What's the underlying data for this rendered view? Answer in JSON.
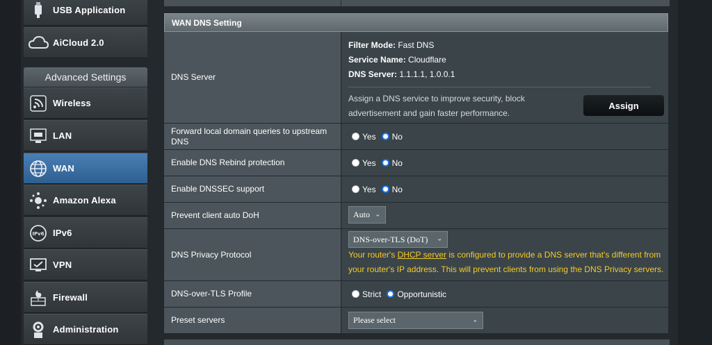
{
  "sidebar": {
    "items_top": [
      {
        "label": "USB Application",
        "icon": "usb-icon"
      },
      {
        "label": "AiCloud 2.0",
        "icon": "cloud-icon"
      }
    ],
    "advanced_header": "Advanced Settings",
    "items": [
      {
        "label": "Wireless",
        "icon": "wireless-icon"
      },
      {
        "label": "LAN",
        "icon": "lan-icon"
      },
      {
        "label": "WAN",
        "icon": "globe-icon",
        "active": true
      },
      {
        "label": "Amazon Alexa",
        "icon": "alexa-icon"
      },
      {
        "label": "IPv6",
        "icon": "ipv6-icon"
      },
      {
        "label": "VPN",
        "icon": "vpn-icon"
      },
      {
        "label": "Firewall",
        "icon": "firewall-icon"
      },
      {
        "label": "Administration",
        "icon": "administration-icon"
      }
    ]
  },
  "section": {
    "title": "WAN DNS Setting"
  },
  "dns_server": {
    "label": "DNS Server",
    "filter_mode_key": "Filter Mode:",
    "filter_mode_val": " Fast DNS",
    "service_name_key": "Service Name:",
    "service_name_val": " Cloudflare",
    "dns_server_key": "DNS Server:",
    "dns_server_val": " 1.1.1.1, 1.0.0.1",
    "assign_desc_1": "Assign a DNS service to improve security, block",
    "assign_desc_2": "advertisement and gain faster performance.",
    "assign_button": "Assign"
  },
  "forward_local": {
    "label": "Forward local domain queries to upstream DNS",
    "yes": "Yes",
    "no": "No",
    "selected": "No"
  },
  "dns_rebind": {
    "label": "Enable DNS Rebind protection",
    "yes": "Yes",
    "no": "No",
    "selected": "No"
  },
  "dnssec": {
    "label": "Enable DNSSEC support",
    "yes": "Yes",
    "no": "No",
    "selected": "No"
  },
  "prevent_doh": {
    "label": "Prevent client auto DoH",
    "value": "Auto"
  },
  "privacy_protocol": {
    "label": "DNS Privacy Protocol",
    "value": "DNS-over-TLS (DoT)",
    "warn_1a": "Your router's ",
    "warn_link": "DHCP server",
    "warn_1b": " is configured to provide a DNS server that's different from",
    "warn_2": "your router's IP address. This will prevent clients from using the DNS Privacy servers."
  },
  "dot_profile": {
    "label": "DNS-over-TLS Profile",
    "strict": "Strict",
    "opportunistic": "Opportunistic",
    "selected": "Opportunistic"
  },
  "preset_servers": {
    "label": "Preset servers",
    "value": "Please select"
  },
  "colors": {
    "accent": "#1a73e8",
    "warning": "#f5cb2a",
    "active_menu": "#3b6fa3"
  }
}
